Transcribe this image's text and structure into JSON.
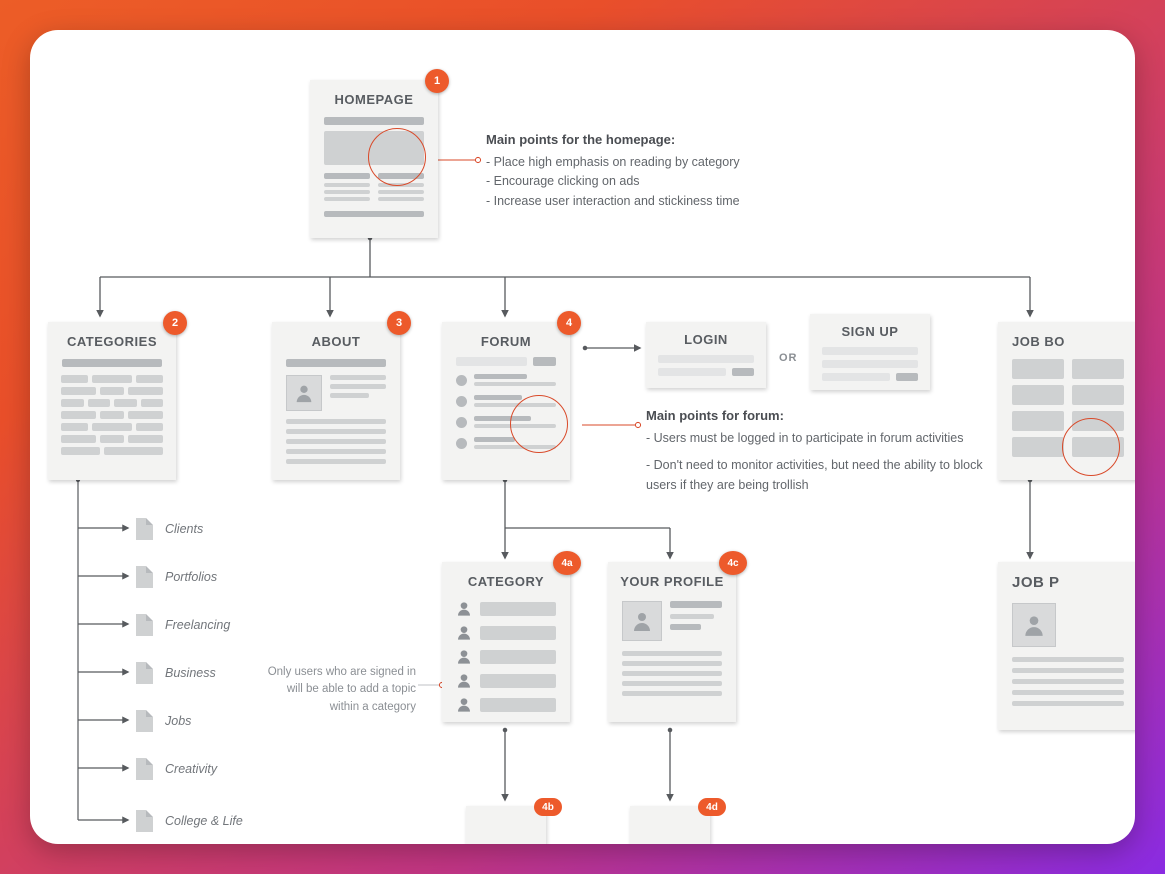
{
  "pages": {
    "homepage": {
      "title": "HOMEPAGE",
      "badge": "1"
    },
    "categories": {
      "title": "CATEGORIES",
      "badge": "2"
    },
    "about": {
      "title": "ABOUT",
      "badge": "3"
    },
    "forum": {
      "title": "FORUM",
      "badge": "4"
    },
    "login": {
      "title": "LOGIN"
    },
    "signup": {
      "title": "SIGN UP"
    },
    "jobboard": {
      "title": "JOB BO"
    },
    "category": {
      "title": "CATEGORY",
      "badge": "4a"
    },
    "profile": {
      "title": "YOUR PROFILE",
      "badge": "4c"
    },
    "jobpost": {
      "title": "JOB P"
    }
  },
  "labels": {
    "or": "OR",
    "sub4b": "4b",
    "sub4d": "4d"
  },
  "annotations": {
    "homepage": {
      "heading": "Main points for the homepage:",
      "l1": "- Place high emphasis on reading by category",
      "l2": "- Encourage clicking on ads",
      "l3": "- Increase user interaction and stickiness time"
    },
    "forum": {
      "heading": "Main points for forum:",
      "l1": "- Users must be logged in to participate in forum activities",
      "l2": "- Don't need to monitor activities, but need the ability to block users if they are being trollish"
    },
    "categorySignin": {
      "l1": "Only users who are signed in",
      "l2": "will be able to add a topic",
      "l3": "within a category"
    }
  },
  "categoryList": {
    "c0": "Clients",
    "c1": "Portfolios",
    "c2": "Freelancing",
    "c3": "Business",
    "c4": "Jobs",
    "c5": "Creativity",
    "c6": "College & Life"
  }
}
